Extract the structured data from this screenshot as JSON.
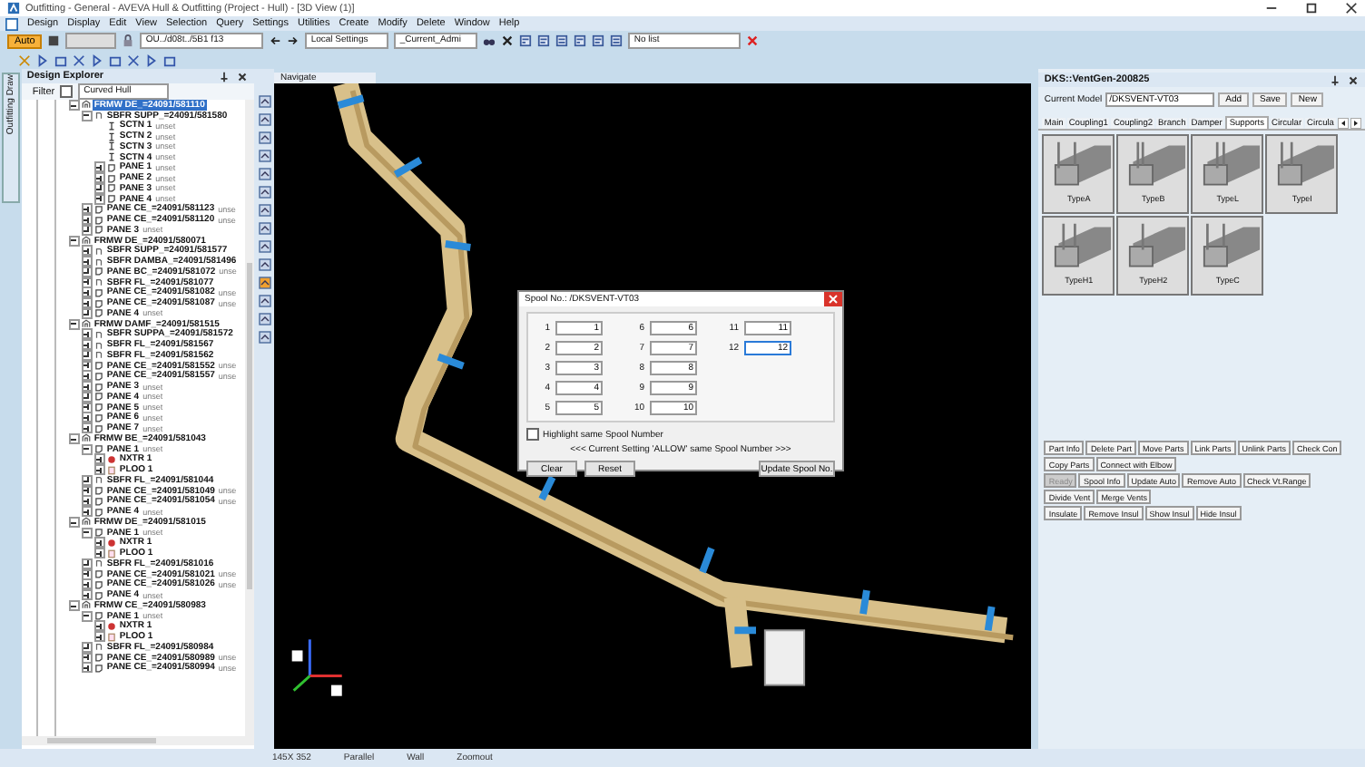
{
  "window": {
    "title": "Outfitting - General - AVEVA Hull & Outfitting (Project - Hull) - [3D View (1)]"
  },
  "menu": [
    "Design",
    "Display",
    "Edit",
    "View",
    "Selection",
    "Query",
    "Settings",
    "Utilities",
    "Create",
    "Modify",
    "Delete",
    "Window",
    "Help"
  ],
  "toolbar": {
    "mode_button": {
      "label": "Auto",
      "selected": true
    },
    "element_combo": "OU../d08t../5B1 f13",
    "settings_combo": "Local Settings",
    "admin_combo": "_Current_Admi",
    "list_combo": "No list"
  },
  "side_tab": "Outfitting Draw",
  "design_explorer": {
    "title": "Design Explorer",
    "filter_label": "Filter",
    "filter_checked": false,
    "filter_value": "Curved Hull",
    "tree": [
      {
        "label": "FRMW DE_=24091/581110",
        "kind": "frame",
        "selected": true,
        "expanded": true,
        "children": [
          {
            "label": "SBFR SUPP_=24091/581580",
            "kind": "subframe",
            "selected": false,
            "expanded": true,
            "children": [
              {
                "label": "SCTN 1",
                "note": "unset",
                "kind": "section",
                "selected": false
              },
              {
                "label": "SCTN 2",
                "note": "unset",
                "kind": "section",
                "selected": false
              },
              {
                "label": "SCTN 3",
                "note": "unset",
                "kind": "section",
                "selected": false
              },
              {
                "label": "SCTN 4",
                "note": "unset",
                "kind": "section",
                "selected": false
              },
              {
                "label": "PANE 1",
                "note": "unset",
                "kind": "panel",
                "selected": false,
                "expanded": false
              },
              {
                "label": "PANE 2",
                "note": "unset",
                "kind": "panel",
                "selected": false,
                "expanded": false
              },
              {
                "label": "PANE 3",
                "note": "unset",
                "kind": "panel",
                "selected": false,
                "expanded": false
              },
              {
                "label": "PANE 4",
                "note": "unset",
                "kind": "panel",
                "selected": false,
                "expanded": false
              }
            ]
          },
          {
            "label": "PANE CE_=24091/581123",
            "note": "unse",
            "kind": "panel",
            "selected": false,
            "expanded": false
          },
          {
            "label": "PANE CE_=24091/581120",
            "note": "unse",
            "kind": "panel",
            "selected": false,
            "expanded": false
          },
          {
            "label": "PANE 3",
            "note": "unset",
            "kind": "panel",
            "selected": false,
            "expanded": false
          }
        ]
      },
      {
        "label": "FRMW DE_=24091/580071",
        "kind": "frame",
        "selected": false,
        "expanded": true,
        "children": [
          {
            "label": "SBFR SUPP_=24091/581577",
            "kind": "subframe",
            "selected": false,
            "expanded": false
          },
          {
            "label": "SBFR DAMBA_=24091/581496",
            "kind": "subframe",
            "selected": false,
            "expanded": false
          },
          {
            "label": "PANE BC_=24091/581072",
            "note": "unse",
            "kind": "panel",
            "selected": false,
            "expanded": false
          },
          {
            "label": "SBFR FL_=24091/581077",
            "kind": "subframe",
            "selected": false,
            "expanded": false
          },
          {
            "label": "PANE CE_=24091/581082",
            "note": "unse",
            "kind": "panel",
            "selected": false,
            "expanded": false
          },
          {
            "label": "PANE CE_=24091/581087",
            "note": "unse",
            "kind": "panel",
            "selected": false,
            "expanded": false
          },
          {
            "label": "PANE 4",
            "note": "unset",
            "kind": "panel",
            "selected": false,
            "expanded": false
          }
        ]
      },
      {
        "label": "FRMW DAMF_=24091/581515",
        "kind": "frame",
        "selected": false,
        "expanded": true,
        "children": [
          {
            "label": "SBFR SUPPA_=24091/581572",
            "kind": "subframe",
            "selected": false,
            "expanded": false
          },
          {
            "label": "SBFR FL_=24091/581567",
            "kind": "subframe",
            "selected": false,
            "expanded": false
          },
          {
            "label": "SBFR FL_=24091/581562",
            "kind": "subframe",
            "selected": false,
            "expanded": false
          },
          {
            "label": "PANE CE_=24091/581552",
            "note": "unse",
            "kind": "panel",
            "selected": false,
            "expanded": false
          },
          {
            "label": "PANE CE_=24091/581557",
            "note": "unse",
            "kind": "panel",
            "selected": false,
            "expanded": false
          },
          {
            "label": "PANE 3",
            "note": "unset",
            "kind": "panel",
            "selected": false,
            "expanded": false
          },
          {
            "label": "PANE 4",
            "note": "unset",
            "kind": "panel",
            "selected": false,
            "expanded": false
          },
          {
            "label": "PANE 5",
            "note": "unset",
            "kind": "panel",
            "selected": false,
            "expanded": false
          },
          {
            "label": "PANE 6",
            "note": "unset",
            "kind": "panel",
            "selected": false,
            "expanded": false
          },
          {
            "label": "PANE 7",
            "note": "unset",
            "kind": "panel",
            "selected": false,
            "expanded": false
          }
        ]
      },
      {
        "label": "FRMW BE_=24091/581043",
        "kind": "frame",
        "selected": false,
        "expanded": true,
        "children": [
          {
            "label": "PANE 1",
            "note": "unset",
            "kind": "panel",
            "selected": false,
            "expanded": true,
            "children": [
              {
                "label": "NXTR 1",
                "kind": "equipment",
                "selected": false,
                "expanded": false
              },
              {
                "label": "PLOO 1",
                "kind": "sheet",
                "selected": false,
                "expanded": false
              }
            ]
          },
          {
            "label": "SBFR FL_=24091/581044",
            "kind": "subframe",
            "selected": false,
            "expanded": false
          },
          {
            "label": "PANE CE_=24091/581049",
            "note": "unse",
            "kind": "panel",
            "selected": false,
            "expanded": false
          },
          {
            "label": "PANE CE_=24091/581054",
            "note": "unse",
            "kind": "panel",
            "selected": false,
            "expanded": false
          },
          {
            "label": "PANE 4",
            "note": "unset",
            "kind": "panel",
            "selected": false,
            "expanded": false
          }
        ]
      },
      {
        "label": "FRMW DE_=24091/581015",
        "kind": "frame",
        "selected": false,
        "expanded": true,
        "children": [
          {
            "label": "PANE 1",
            "note": "unset",
            "kind": "panel",
            "selected": false,
            "expanded": true,
            "children": [
              {
                "label": "NXTR 1",
                "kind": "equipment",
                "selected": false,
                "expanded": false
              },
              {
                "label": "PLOO 1",
                "kind": "sheet",
                "selected": false,
                "expanded": false
              }
            ]
          },
          {
            "label": "SBFR FL_=24091/581016",
            "kind": "subframe",
            "selected": false,
            "expanded": false
          },
          {
            "label": "PANE CE_=24091/581021",
            "note": "unse",
            "kind": "panel",
            "selected": false,
            "expanded": false
          },
          {
            "label": "PANE CE_=24091/581026",
            "note": "unse",
            "kind": "panel",
            "selected": false,
            "expanded": false
          },
          {
            "label": "PANE 4",
            "note": "unset",
            "kind": "panel",
            "selected": false,
            "expanded": false
          }
        ]
      },
      {
        "label": "FRMW CE_=24091/580983",
        "kind": "frame",
        "selected": false,
        "expanded": true,
        "children": [
          {
            "label": "PANE 1",
            "note": "unset",
            "kind": "panel",
            "selected": false,
            "expanded": true,
            "children": [
              {
                "label": "NXTR 1",
                "kind": "equipment",
                "selected": false,
                "expanded": false
              },
              {
                "label": "PLOO 1",
                "kind": "sheet",
                "selected": false,
                "expanded": false
              }
            ]
          },
          {
            "label": "SBFR FL_=24091/580984",
            "kind": "subframe",
            "selected": false,
            "expanded": false
          },
          {
            "label": "PANE CE_=24091/580989",
            "note": "unse",
            "kind": "panel",
            "selected": false,
            "expanded": false
          },
          {
            "label": "PANE CE_=24091/580994",
            "note": "unse",
            "kind": "panel",
            "selected": false,
            "expanded": false
          }
        ]
      }
    ]
  },
  "view": {
    "title": "Navigate"
  },
  "spool_dialog": {
    "title": "Spool No.: /DKSVENT-VT03",
    "fields": [
      {
        "label": "1",
        "value": "1",
        "focused": false
      },
      {
        "label": "2",
        "value": "2",
        "focused": false
      },
      {
        "label": "3",
        "value": "3",
        "focused": false
      },
      {
        "label": "4",
        "value": "4",
        "focused": false
      },
      {
        "label": "5",
        "value": "5",
        "focused": false
      },
      {
        "label": "6",
        "value": "6",
        "focused": false
      },
      {
        "label": "7",
        "value": "7",
        "focused": false
      },
      {
        "label": "8",
        "value": "8",
        "focused": false
      },
      {
        "label": "9",
        "value": "9",
        "focused": false
      },
      {
        "label": "10",
        "value": "10",
        "focused": false
      },
      {
        "label": "11",
        "value": "11",
        "focused": false
      },
      {
        "label": "12",
        "value": "12",
        "focused": true
      }
    ],
    "highlight": {
      "label": "Highlight same Spool Number",
      "checked": false
    },
    "message": "<<< Current Setting 'ALLOW' same Spool Number >>>",
    "buttons": [
      "Clear",
      "Reset",
      "Update Spool No."
    ]
  },
  "ventgen": {
    "title": "DKS::VentGen-200825",
    "model_label": "Current Model",
    "model_value": "/DKSVENT-VT03",
    "model_buttons": [
      "Add",
      "Save",
      "New"
    ],
    "tabs": [
      {
        "label": "Main",
        "selected": false
      },
      {
        "label": "Coupling1",
        "selected": false
      },
      {
        "label": "Coupling2",
        "selected": false
      },
      {
        "label": "Branch",
        "selected": false
      },
      {
        "label": "Damper",
        "selected": false
      },
      {
        "label": "Supports",
        "selected": true
      },
      {
        "label": "Circular",
        "selected": false
      },
      {
        "label": "Circula",
        "selected": false
      }
    ],
    "support_types": [
      "TypeA",
      "TypeB",
      "TypeL",
      "TypeI",
      "TypeH1",
      "TypeH2",
      "TypeC"
    ],
    "action_rows": [
      [
        {
          "label": "Part Info",
          "disabled": false
        },
        {
          "label": "Delete Part",
          "disabled": false
        },
        {
          "label": "Move Parts",
          "disabled": false
        },
        {
          "label": "Link Parts",
          "disabled": false
        },
        {
          "label": "Unlink Parts",
          "disabled": false
        },
        {
          "label": "Check Con",
          "disabled": false
        }
      ],
      [
        {
          "label": "Copy Parts",
          "disabled": false
        },
        {
          "label": "Connect with Elbow",
          "disabled": false
        }
      ],
      [
        {
          "label": "Ready",
          "disabled": true
        },
        {
          "label": "Spool Info",
          "disabled": false
        },
        {
          "label": "Update Auto",
          "disabled": false
        },
        {
          "label": "Remove Auto",
          "disabled": false
        },
        {
          "label": "Check Vt.Range",
          "disabled": false
        }
      ],
      [
        {
          "label": "Divide Vent",
          "disabled": false
        },
        {
          "label": "Merge Vents",
          "disabled": false
        }
      ],
      [
        {
          "label": "Insulate",
          "disabled": false
        },
        {
          "label": "Remove Insul",
          "disabled": false
        },
        {
          "label": "Show Insul",
          "disabled": false
        },
        {
          "label": "Hide Insul",
          "disabled": false
        }
      ]
    ]
  },
  "status_bar": [
    "145X 352",
    "Parallel",
    "Wall",
    "Zoomout"
  ]
}
